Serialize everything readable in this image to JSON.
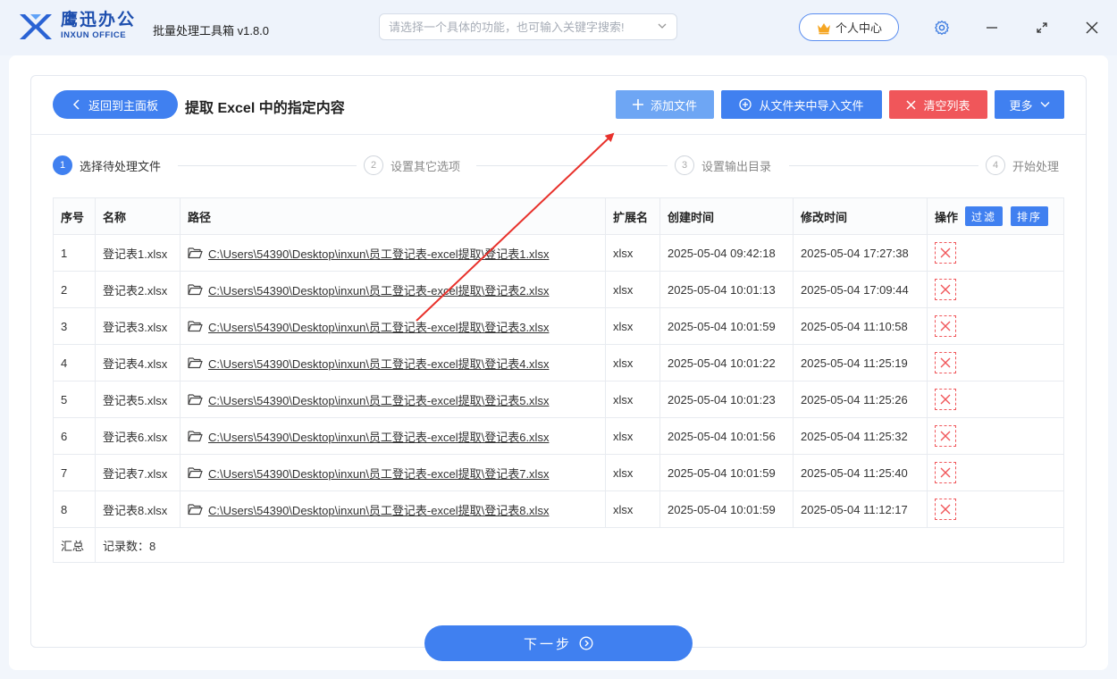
{
  "app": {
    "brand_cn": "鹰迅办公",
    "brand_en": "INXUN OFFICE",
    "title": "批量处理工具箱 v1.8.0",
    "search_placeholder": "请选择一个具体的功能，也可输入关键字搜索!",
    "user_center": "个人中心"
  },
  "toolbar": {
    "back_label": "返回到主面板",
    "page_title": "提取 Excel 中的指定内容",
    "add_file": "添加文件",
    "import_folder": "从文件夹中导入文件",
    "clear_list": "清空列表",
    "more": "更多"
  },
  "steps": [
    {
      "num": "1",
      "label": "选择待处理文件",
      "active": true
    },
    {
      "num": "2",
      "label": "设置其它选项",
      "active": false
    },
    {
      "num": "3",
      "label": "设置输出目录",
      "active": false
    },
    {
      "num": "4",
      "label": "开始处理",
      "active": false
    }
  ],
  "table": {
    "headers": {
      "index": "序号",
      "name": "名称",
      "path": "路径",
      "ext": "扩展名",
      "created": "创建时间",
      "modified": "修改时间",
      "action": "操作"
    },
    "filter_label": "过滤",
    "sort_label": "排序",
    "rows": [
      {
        "index": "1",
        "name": "登记表1.xlsx",
        "path": "C:\\Users\\54390\\Desktop\\inxun\\员工登记表-excel提取\\登记表1.xlsx",
        "ext": "xlsx",
        "created": "2025-05-04 09:42:18",
        "modified": "2025-05-04 17:27:38"
      },
      {
        "index": "2",
        "name": "登记表2.xlsx",
        "path": "C:\\Users\\54390\\Desktop\\inxun\\员工登记表-excel提取\\登记表2.xlsx",
        "ext": "xlsx",
        "created": "2025-05-04 10:01:13",
        "modified": "2025-05-04 17:09:44"
      },
      {
        "index": "3",
        "name": "登记表3.xlsx",
        "path": "C:\\Users\\54390\\Desktop\\inxun\\员工登记表-excel提取\\登记表3.xlsx",
        "ext": "xlsx",
        "created": "2025-05-04 10:01:59",
        "modified": "2025-05-04 11:10:58"
      },
      {
        "index": "4",
        "name": "登记表4.xlsx",
        "path": "C:\\Users\\54390\\Desktop\\inxun\\员工登记表-excel提取\\登记表4.xlsx",
        "ext": "xlsx",
        "created": "2025-05-04 10:01:22",
        "modified": "2025-05-04 11:25:19"
      },
      {
        "index": "5",
        "name": "登记表5.xlsx",
        "path": "C:\\Users\\54390\\Desktop\\inxun\\员工登记表-excel提取\\登记表5.xlsx",
        "ext": "xlsx",
        "created": "2025-05-04 10:01:23",
        "modified": "2025-05-04 11:25:26"
      },
      {
        "index": "6",
        "name": "登记表6.xlsx",
        "path": "C:\\Users\\54390\\Desktop\\inxun\\员工登记表-excel提取\\登记表6.xlsx",
        "ext": "xlsx",
        "created": "2025-05-04 10:01:56",
        "modified": "2025-05-04 11:25:32"
      },
      {
        "index": "7",
        "name": "登记表7.xlsx",
        "path": "C:\\Users\\54390\\Desktop\\inxun\\员工登记表-excel提取\\登记表7.xlsx",
        "ext": "xlsx",
        "created": "2025-05-04 10:01:59",
        "modified": "2025-05-04 11:25:40"
      },
      {
        "index": "8",
        "name": "登记表8.xlsx",
        "path": "C:\\Users\\54390\\Desktop\\inxun\\员工登记表-excel提取\\登记表8.xlsx",
        "ext": "xlsx",
        "created": "2025-05-04 10:01:59",
        "modified": "2025-05-04 11:12:17"
      }
    ],
    "summary_label": "汇总",
    "summary_count": "记录数：8"
  },
  "next_label": "下一步",
  "colors": {
    "primary": "#4080f0",
    "add_button": "#6ea6f4",
    "danger": "#f0565a",
    "annotation_arrow": "#e8312b"
  },
  "icons": [
    "logo-icon",
    "chevron-down-icon",
    "crown-icon",
    "gear-icon",
    "minimize-icon",
    "maximize-icon",
    "close-icon",
    "back-chevron-icon",
    "plus-icon",
    "add-circle-icon",
    "x-icon",
    "folder-icon",
    "delete-icon",
    "next-circle-icon"
  ]
}
